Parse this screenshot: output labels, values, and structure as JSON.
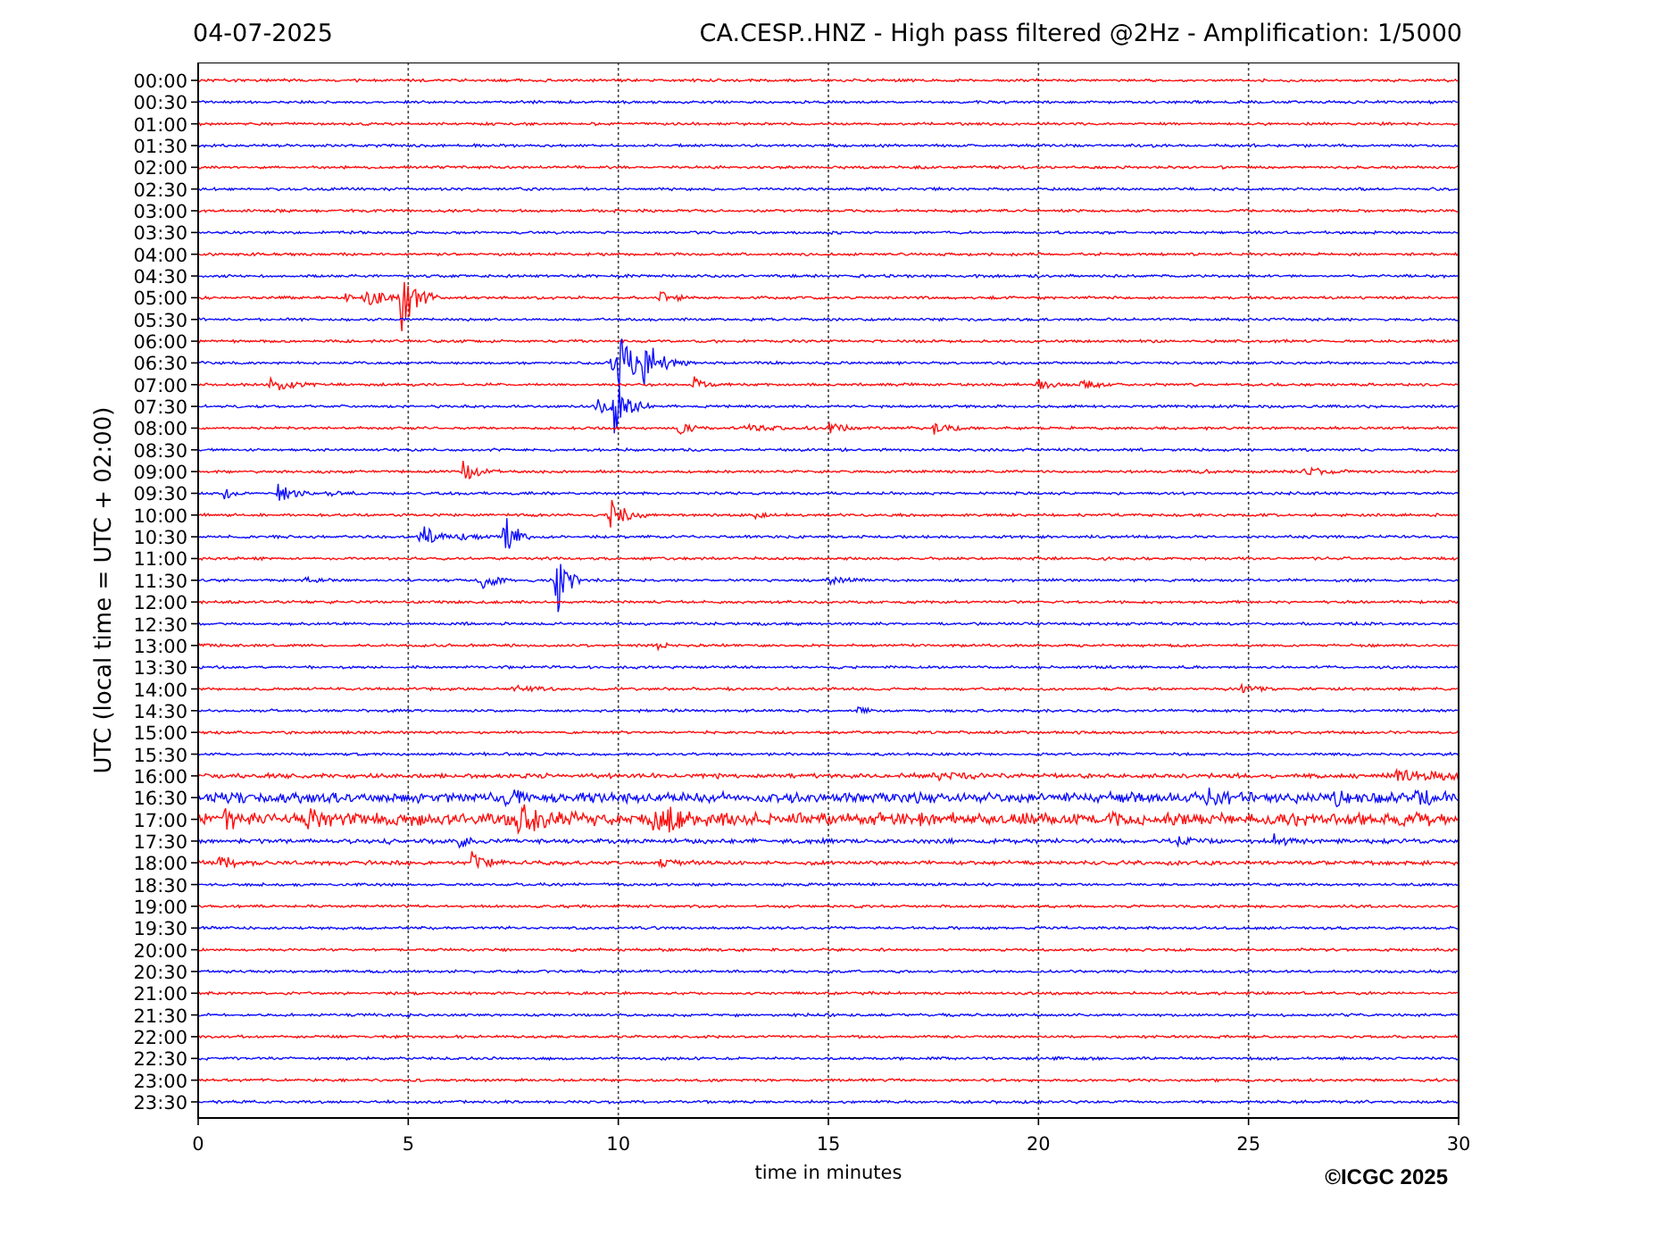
{
  "header": {
    "date": "04-07-2025",
    "title": "CA.CESP..HNZ - High pass filtered @2Hz - Amplification: 1/5000"
  },
  "plot": {
    "ylabel": "UTC (local time = UTC + 02:00)",
    "xlabel": "time in minutes",
    "xticks": [
      "0",
      "5",
      "10",
      "15",
      "20",
      "25",
      "30"
    ],
    "traces": [
      {
        "label": "00:00",
        "color": "#ff0000"
      },
      {
        "label": "00:30",
        "color": "#0000ff"
      },
      {
        "label": "01:00",
        "color": "#ff0000"
      },
      {
        "label": "01:30",
        "color": "#0000ff"
      },
      {
        "label": "02:00",
        "color": "#ff0000"
      },
      {
        "label": "02:30",
        "color": "#0000ff"
      },
      {
        "label": "03:00",
        "color": "#ff0000"
      },
      {
        "label": "03:30",
        "color": "#0000ff"
      },
      {
        "label": "04:00",
        "color": "#ff0000"
      },
      {
        "label": "04:30",
        "color": "#0000ff"
      },
      {
        "label": "05:00",
        "color": "#ff0000"
      },
      {
        "label": "05:30",
        "color": "#0000ff"
      },
      {
        "label": "06:00",
        "color": "#ff0000"
      },
      {
        "label": "06:30",
        "color": "#0000ff"
      },
      {
        "label": "07:00",
        "color": "#ff0000"
      },
      {
        "label": "07:30",
        "color": "#0000ff"
      },
      {
        "label": "08:00",
        "color": "#ff0000"
      },
      {
        "label": "08:30",
        "color": "#0000ff"
      },
      {
        "label": "09:00",
        "color": "#ff0000"
      },
      {
        "label": "09:30",
        "color": "#0000ff"
      },
      {
        "label": "10:00",
        "color": "#ff0000"
      },
      {
        "label": "10:30",
        "color": "#0000ff"
      },
      {
        "label": "11:00",
        "color": "#ff0000"
      },
      {
        "label": "11:30",
        "color": "#0000ff"
      },
      {
        "label": "12:00",
        "color": "#ff0000"
      },
      {
        "label": "12:30",
        "color": "#0000ff"
      },
      {
        "label": "13:00",
        "color": "#ff0000"
      },
      {
        "label": "13:30",
        "color": "#0000ff"
      },
      {
        "label": "14:00",
        "color": "#ff0000"
      },
      {
        "label": "14:30",
        "color": "#0000ff"
      },
      {
        "label": "15:00",
        "color": "#ff0000"
      },
      {
        "label": "15:30",
        "color": "#0000ff"
      },
      {
        "label": "16:00",
        "color": "#ff0000"
      },
      {
        "label": "16:30",
        "color": "#0000ff"
      },
      {
        "label": "17:00",
        "color": "#ff0000"
      },
      {
        "label": "17:30",
        "color": "#0000ff"
      },
      {
        "label": "18:00",
        "color": "#ff0000"
      },
      {
        "label": "18:30",
        "color": "#0000ff"
      },
      {
        "label": "19:00",
        "color": "#ff0000"
      },
      {
        "label": "19:30",
        "color": "#0000ff"
      },
      {
        "label": "20:00",
        "color": "#ff0000"
      },
      {
        "label": "20:30",
        "color": "#0000ff"
      },
      {
        "label": "21:00",
        "color": "#ff0000"
      },
      {
        "label": "21:30",
        "color": "#0000ff"
      },
      {
        "label": "22:00",
        "color": "#ff0000"
      },
      {
        "label": "22:30",
        "color": "#0000ff"
      },
      {
        "label": "23:00",
        "color": "#ff0000"
      },
      {
        "label": "23:30",
        "color": "#0000ff"
      }
    ]
  },
  "credit": "©ICGC 2025"
}
